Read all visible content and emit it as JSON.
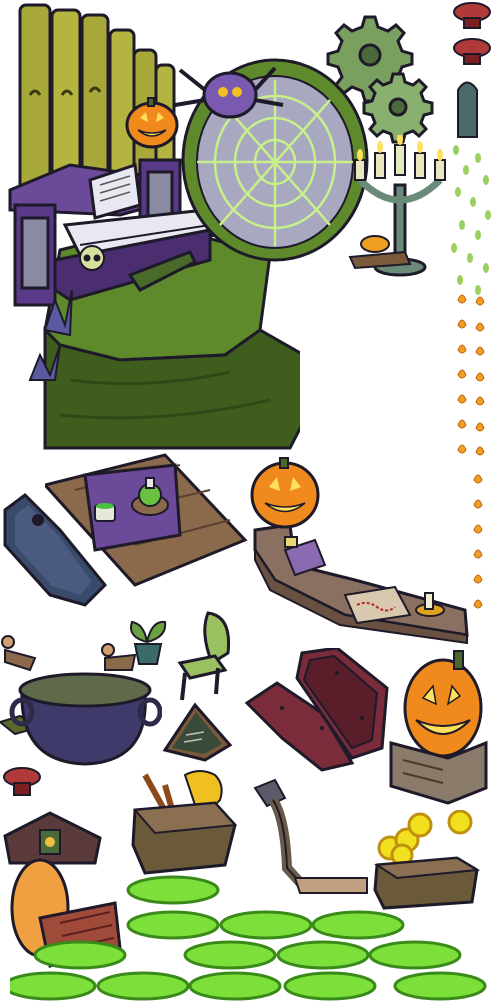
{
  "sheet": {
    "background": "#ffffff",
    "palette": {
      "outline": "#1e1a2a",
      "purple": "#6b4a9a",
      "purple_dark": "#3e2a60",
      "green_floor": "#5e8a2c",
      "green_floor_dark": "#3f5e1e",
      "olive_pipe": "#a8a83a",
      "olive_pipe_dark": "#6a6a20",
      "pumpkin": "#f08a1c",
      "pumpkin_glow": "#ffe05a",
      "wood": "#8a6a4a",
      "wood_dark": "#5a4030",
      "maroon": "#7a2c3a",
      "slime": "#7de03a",
      "slime_dark": "#3a8a1a",
      "web_grey": "#8a8aa0",
      "gear_green": "#7aa060"
    },
    "sprites": [
      {
        "name": "organ-stage",
        "icon": "pipe-organ-icon"
      },
      {
        "name": "spider-web-portal",
        "icon": "spider-web-icon"
      },
      {
        "name": "gear-pair",
        "icon": "gear-icon"
      },
      {
        "name": "candelabra",
        "icon": "candelabra-icon"
      },
      {
        "name": "button-stack",
        "icon": "round-button-icon"
      },
      {
        "name": "window-shutter",
        "icon": "arch-window-icon"
      },
      {
        "name": "leaf-particles",
        "icon": "leaf-icon"
      },
      {
        "name": "flame-particles",
        "icon": "flame-icon"
      },
      {
        "name": "coffin-closed",
        "icon": "coffin-icon"
      },
      {
        "name": "potion-table",
        "icon": "potion-icon"
      },
      {
        "name": "pumpkin-counter",
        "icon": "jack-o-lantern-icon"
      },
      {
        "name": "cash-register",
        "icon": "cash-register-icon"
      },
      {
        "name": "treasure-map",
        "icon": "map-icon"
      },
      {
        "name": "potted-plant",
        "icon": "plant-icon"
      },
      {
        "name": "green-chair",
        "icon": "chair-icon"
      },
      {
        "name": "cauldron",
        "icon": "cauldron-icon"
      },
      {
        "name": "chalkboard-sign",
        "icon": "chalkboard-icon"
      },
      {
        "name": "open-coffin",
        "icon": "open-coffin-icon"
      },
      {
        "name": "pumpkin-dresser",
        "icon": "jack-o-lantern-icon"
      },
      {
        "name": "broom-crate",
        "icon": "broom-icon"
      },
      {
        "name": "lamp-post",
        "icon": "lamp-post-icon"
      },
      {
        "name": "gold-coin-crate",
        "icon": "coin-icon"
      },
      {
        "name": "cuckoo-clock",
        "icon": "clock-icon"
      },
      {
        "name": "slime-puddles",
        "icon": "slime-puddle-icon"
      }
    ]
  }
}
